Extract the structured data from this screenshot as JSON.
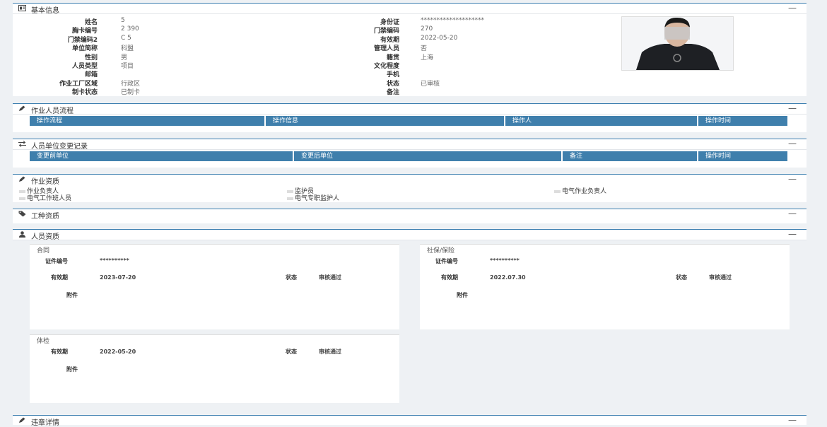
{
  "basic": {
    "title": "基本信息",
    "left": [
      {
        "label": "姓名",
        "value": "5"
      },
      {
        "label": "胸卡编号",
        "value": "2    390"
      },
      {
        "label": "门禁编码2",
        "value": "C        5"
      },
      {
        "label": "单位简称",
        "value": "科盟"
      },
      {
        "label": "性别",
        "value": "男"
      },
      {
        "label": "人员类型",
        "value": "项目"
      },
      {
        "label": "邮箱",
        "value": ""
      },
      {
        "label": "作业工厂区域",
        "value": "行政区"
      },
      {
        "label": "制卡状态",
        "value": "已制卡"
      }
    ],
    "right": [
      {
        "label": "身份证",
        "value": "********************"
      },
      {
        "label": "门禁编码",
        "value": "270"
      },
      {
        "label": "有效期",
        "value": "2022-05-20"
      },
      {
        "label": "管理人员",
        "value": "否"
      },
      {
        "label": "籍贯",
        "value": "上海"
      },
      {
        "label": "文化程度",
        "value": ""
      },
      {
        "label": "手机",
        "value": ""
      },
      {
        "label": "状态",
        "value": "已审核"
      },
      {
        "label": "备注",
        "value": ""
      }
    ]
  },
  "flow": {
    "title": "作业人员流程",
    "columns": [
      "操作流程",
      "操作信息",
      "操作人",
      "操作时间"
    ]
  },
  "change": {
    "title": "人员单位变更记录",
    "columns": [
      "变更前单位",
      "变更后单位",
      "备注",
      "操作时间"
    ]
  },
  "work_qual": {
    "title": "作业资质",
    "items": [
      "作业负责人",
      "监护员",
      "电气作业负责人",
      "电气工作班人员",
      "电气专职监护人"
    ]
  },
  "trade_qual": {
    "title": "工种资质"
  },
  "person_qual": {
    "title": "人员资质",
    "contract": {
      "title": "合同",
      "cert_label": "证件编号",
      "cert_value": "**********",
      "valid_label": "有效期",
      "valid_value": "2023-07-20",
      "status_label": "状态",
      "status_value": "审核通过",
      "attach_label": "附件"
    },
    "social": {
      "title": "社保/保险",
      "cert_label": "证件编号",
      "cert_value": "**********",
      "valid_label": "有效期",
      "valid_value": "2022.07.30",
      "status_label": "状态",
      "status_value": "审核通过",
      "attach_label": "附件"
    },
    "exam": {
      "title": "体检",
      "valid_label": "有效期",
      "valid_value": "2022-05-20",
      "status_label": "状态",
      "status_value": "审核通过",
      "attach_label": "附件"
    }
  },
  "violation": {
    "title": "违章详情"
  },
  "collapse_symbol": "—"
}
